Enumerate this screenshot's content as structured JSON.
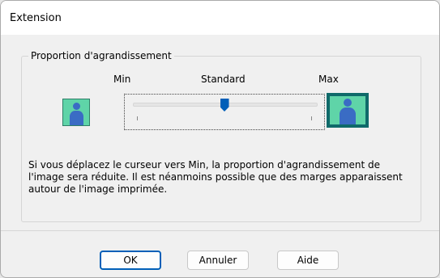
{
  "window": {
    "title": "Extension"
  },
  "group": {
    "legend": "Proportion d'agrandissement",
    "scale_labels": {
      "min": "Min",
      "standard": "Standard",
      "max": "Max"
    },
    "slider": {
      "value_fraction": 0.5
    },
    "description": "Si vous déplacez le curseur vers Min, la proportion d'agrandissement de\nl'image sera réduite. Il est néanmoins possible que des marges apparaissent\nautour de l'image imprimée."
  },
  "buttons": {
    "ok": "OK",
    "cancel": "Annuler",
    "help": "Aide"
  },
  "colors": {
    "accent": "#005fb8",
    "preview_bg": "#5fd4a8",
    "person": "#3a6cc4",
    "max_frame": "#0f6a6a"
  }
}
